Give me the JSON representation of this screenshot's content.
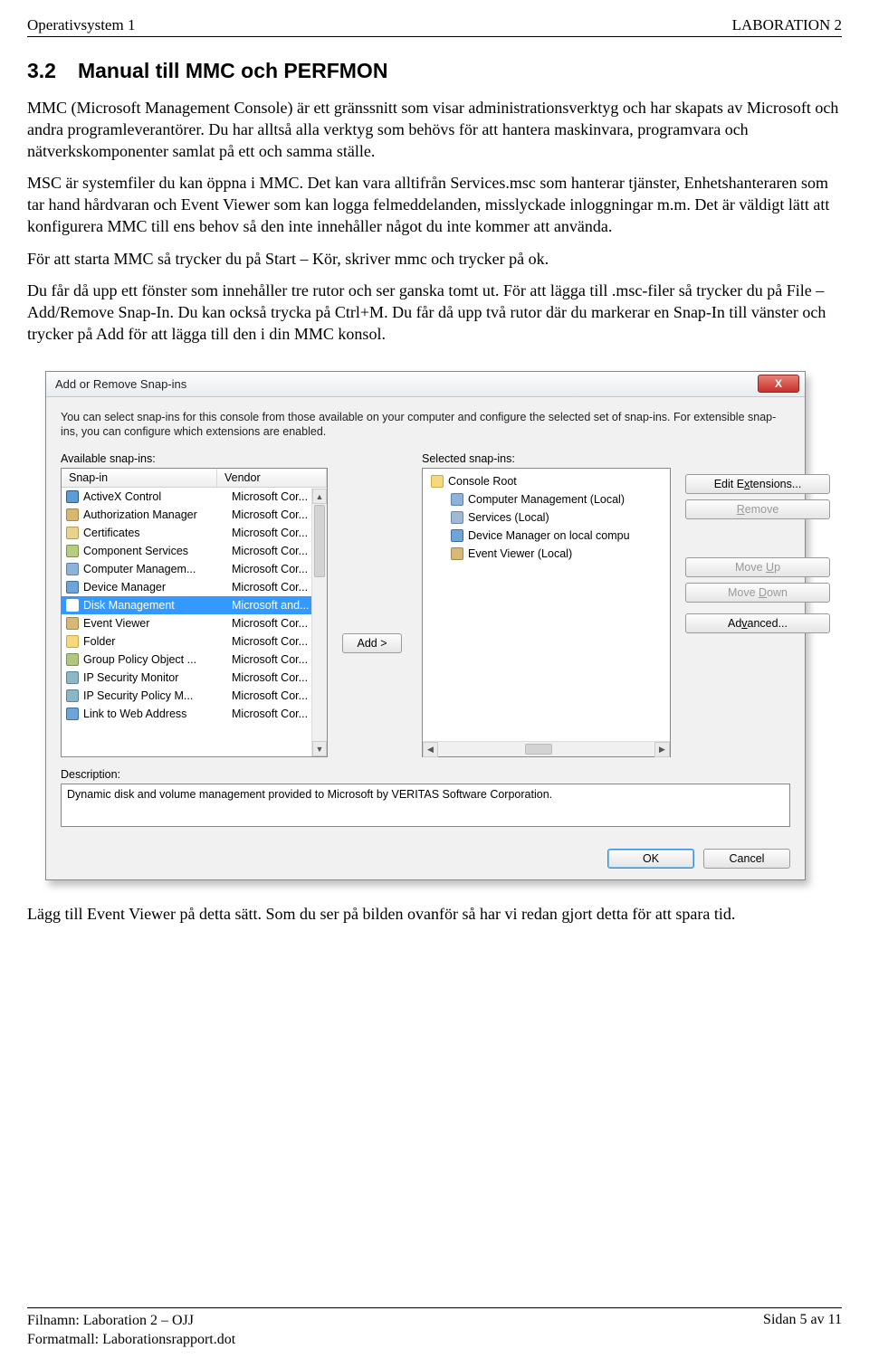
{
  "header": {
    "left": "Operativsystem 1",
    "right": "LABORATION 2"
  },
  "section": {
    "num": "3.2",
    "title": "Manual till MMC och PERFMON"
  },
  "paragraphs": {
    "p1": "MMC (Microsoft Management Console) är ett gränssnitt som visar administrationsverktyg och har skapats av Microsoft och andra programleverantörer. Du har alltså alla verktyg som behövs för att hantera maskinvara, programvara och nätverkskomponenter samlat på ett och samma ställe.",
    "p2": "MSC är systemfiler du kan öppna i MMC. Det kan vara alltifrån Services.msc som hanterar tjänster, Enhetshanteraren som tar hand hårdvaran och Event Viewer som kan logga felmeddelanden, misslyckade inloggningar m.m. Det är väldigt lätt att konfigurera MMC till ens behov så den inte innehåller något du inte kommer att använda.",
    "p3": "För att starta MMC så trycker du på Start – Kör, skriver mmc och trycker på ok.",
    "p4": "Du får då upp ett fönster som innehåller tre rutor och ser ganska tomt ut. För att lägga till .msc-filer så trycker du på File – Add/Remove Snap-In. Du kan också trycka på Ctrl+M. Du får då upp två rutor där du markerar en Snap-In till vänster och trycker på Add för att lägga till den i din MMC konsol.",
    "p5": "Lägg till Event Viewer på detta sätt. Som du ser på bilden ovanför så har vi redan gjort detta för att spara tid."
  },
  "dialog": {
    "title": "Add or Remove Snap-ins",
    "close": "X",
    "intro": "You can select snap-ins for this console from those available on your computer and configure the selected set of snap-ins. For extensible snap-ins, you can configure which extensions are enabled.",
    "labels": {
      "available": "Available snap-ins:",
      "selected": "Selected snap-ins:",
      "snapcol": "Snap-in",
      "vendorcol": "Vendor",
      "desc": "Description:"
    },
    "buttons": {
      "add": "Add >",
      "editext": "Edit Extensions...",
      "remove": "Remove",
      "moveup": "Move Up",
      "movedown": "Move Down",
      "advanced": "Advanced...",
      "ok": "OK",
      "cancel": "Cancel"
    },
    "available": [
      {
        "icon": "ic-activex",
        "name": "ActiveX Control",
        "vendor": "Microsoft Cor..."
      },
      {
        "icon": "ic-auth",
        "name": "Authorization Manager",
        "vendor": "Microsoft Cor..."
      },
      {
        "icon": "ic-cert",
        "name": "Certificates",
        "vendor": "Microsoft Cor..."
      },
      {
        "icon": "ic-comp",
        "name": "Component Services",
        "vendor": "Microsoft Cor..."
      },
      {
        "icon": "ic-compman",
        "name": "Computer Managem...",
        "vendor": "Microsoft Cor..."
      },
      {
        "icon": "ic-devman",
        "name": "Device Manager",
        "vendor": "Microsoft Cor..."
      },
      {
        "icon": "ic-disk",
        "name": "Disk Management",
        "vendor": "Microsoft and...",
        "selected": true
      },
      {
        "icon": "ic-event",
        "name": "Event Viewer",
        "vendor": "Microsoft Cor..."
      },
      {
        "icon": "ic-folder",
        "name": "Folder",
        "vendor": "Microsoft Cor..."
      },
      {
        "icon": "ic-gpo",
        "name": "Group Policy Object ...",
        "vendor": "Microsoft Cor..."
      },
      {
        "icon": "ic-ipsec",
        "name": "IP Security Monitor",
        "vendor": "Microsoft Cor..."
      },
      {
        "icon": "ic-ipsec",
        "name": "IP Security Policy M...",
        "vendor": "Microsoft Cor..."
      },
      {
        "icon": "ic-link",
        "name": "Link to Web Address",
        "vendor": "Microsoft Cor..."
      }
    ],
    "selected": [
      {
        "icon": "ic-root",
        "name": "Console Root",
        "indent": 0
      },
      {
        "icon": "ic-compman",
        "name": "Computer Management (Local)",
        "indent": 1
      },
      {
        "icon": "ic-serv",
        "name": "Services (Local)",
        "indent": 1
      },
      {
        "icon": "ic-devman",
        "name": "Device Manager on local compu",
        "indent": 1
      },
      {
        "icon": "ic-event",
        "name": "Event Viewer (Local)",
        "indent": 1
      }
    ],
    "description": "Dynamic disk and volume management provided to Microsoft by VERITAS Software Corporation."
  },
  "footer": {
    "file": "Filnamn: Laboration 2 – OJJ",
    "template": "Formatmall: Laborationsrapport.dot",
    "page": "Sidan 5 av 11"
  }
}
